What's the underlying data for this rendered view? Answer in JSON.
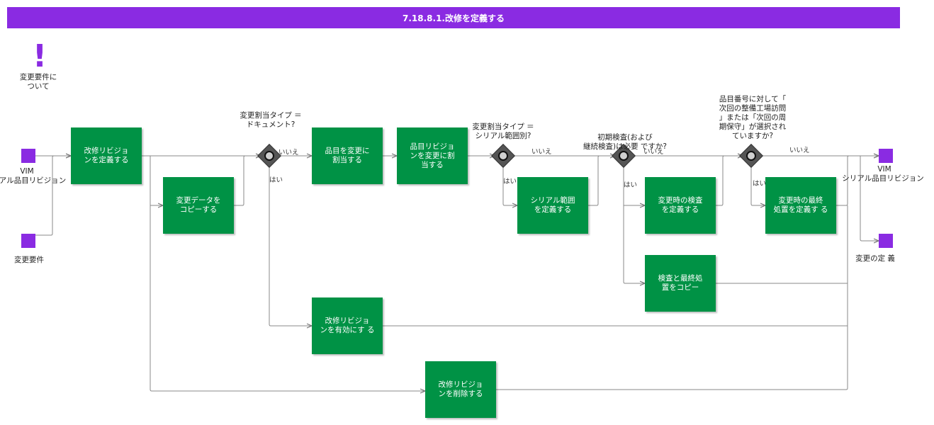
{
  "title": "7.18.8.1.改修を定義する",
  "note": {
    "icon": "exclamation-icon",
    "label": "変更要件に\nついて"
  },
  "inputs": {
    "vim_label_1": "VIM",
    "vim_label_2": "アル品目リビジョン",
    "requirement": "変更要件"
  },
  "outputs": {
    "vim_label_1": "VIM",
    "vim_label_2": "シリアル品目リビジョン",
    "definition": "変更の定 義"
  },
  "tasks": {
    "define_revision": "改修リビジョ\nンを定義する",
    "copy_data": "変更データを\nコピーする",
    "assign_item": "品目を変更に\n割当する",
    "assign_item_revision": "品目リビジョ\nンを変更に割\n当する",
    "define_serial_range": "シリアル範囲\nを定義する",
    "define_inspection": "変更時の検査\nを定義する",
    "define_final_disposition": "変更時の最終\n処置を定義す る",
    "copy_inspection_disposition": "検査と最終処\n置をコピー",
    "enable_revision": "改修リビジョ\nンを有効にす る",
    "delete_revision": "改修リビジョ\nンを削除する"
  },
  "gateways": {
    "g1": "変更割当タイプ ＝\nドキュメント?",
    "g2": "変更割当タイプ ＝\nシリアル範囲別?",
    "g3": "初期検査(および\n継続検査)は必要 ですか?",
    "g4": "品目番号に対して「\n次回の整備工場訪問\n」または「次回の周\n期保守」が選択され\nていますか?"
  },
  "branch_labels": {
    "yes": "はい",
    "no": "いいえ"
  },
  "colors": {
    "header": "#8a2be2",
    "task": "#009245",
    "data_object": "#8a2be2",
    "gateway": "#555555",
    "connector": "#777777"
  }
}
